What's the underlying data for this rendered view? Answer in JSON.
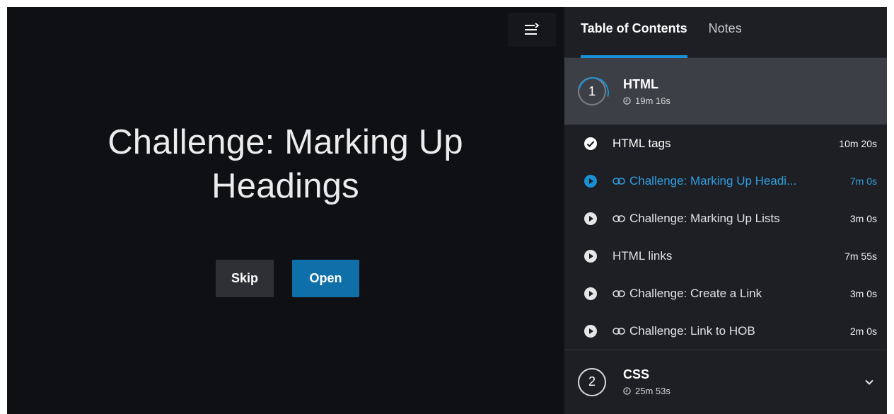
{
  "player": {
    "title": "Challenge: Marking Up Headings",
    "skip_label": "Skip",
    "open_label": "Open",
    "toggle_icon": "sidebar-toggle-icon"
  },
  "sidebar": {
    "tabs": [
      {
        "label": "Table of Contents",
        "active": true
      },
      {
        "label": "Notes",
        "active": false
      }
    ],
    "modules": [
      {
        "number": "1",
        "title": "HTML",
        "duration": "19m 16s",
        "expanded": true,
        "items": [
          {
            "label": "HTML tags",
            "time": "10m 20s",
            "status": "completed",
            "type": "video"
          },
          {
            "label": "Challenge: Marking Up Headi...",
            "time": "7m 0s",
            "status": "current",
            "type": "challenge"
          },
          {
            "label": "Challenge: Marking Up Lists",
            "time": "3m 0s",
            "status": "unwatched",
            "type": "challenge"
          },
          {
            "label": "HTML links",
            "time": "7m 55s",
            "status": "unwatched",
            "type": "video"
          },
          {
            "label": "Challenge: Create a Link",
            "time": "3m 0s",
            "status": "unwatched",
            "type": "challenge"
          },
          {
            "label": "Challenge: Link to HOB",
            "time": "2m 0s",
            "status": "unwatched",
            "type": "challenge"
          }
        ]
      },
      {
        "number": "2",
        "title": "CSS",
        "duration": "25m 53s",
        "expanded": false
      }
    ]
  },
  "colors": {
    "accent": "#1a90d4",
    "current_text": "#2f9ee0",
    "open_button": "#0f6fa8",
    "player_bg": "#0f1014",
    "sidebar_bg": "#1e1f24"
  }
}
